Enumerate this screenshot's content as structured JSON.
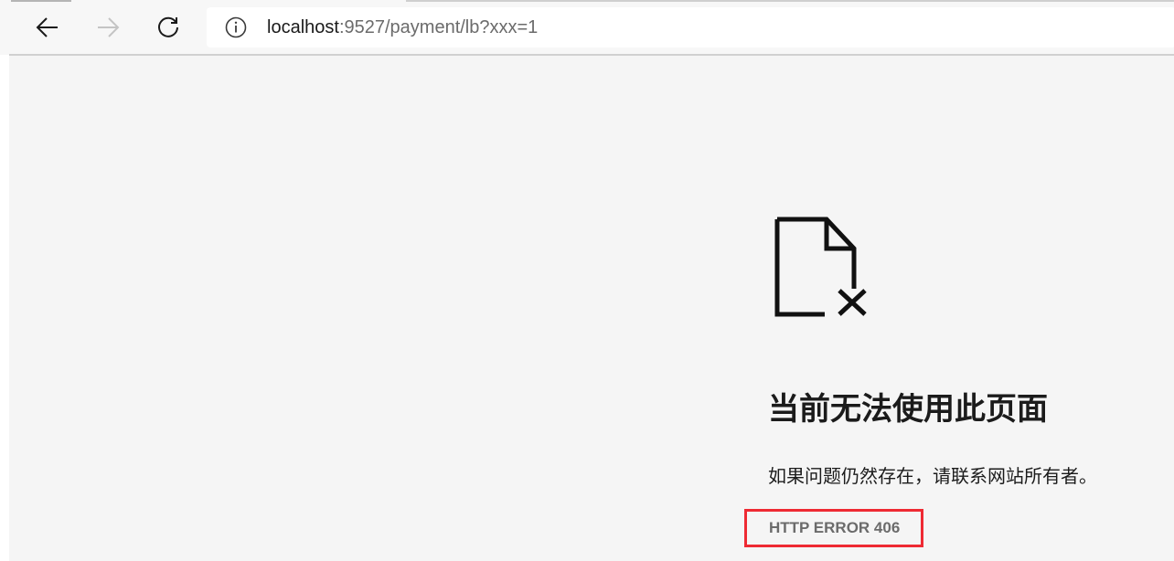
{
  "browser": {
    "address": {
      "host": "localhost",
      "rest": ":9527/payment/lb?xxx=1"
    },
    "icons": {
      "back": "arrow-left-icon",
      "forward": "arrow-right-icon",
      "reload": "reload-icon",
      "site_info": "info-icon"
    }
  },
  "error_page": {
    "icon": "broken-document-icon",
    "title": "当前无法使用此页面",
    "description": "如果问题仍然存在，请联系网站所有者。",
    "code": "HTTP ERROR 406",
    "highlight_color": "#ee2a33"
  }
}
